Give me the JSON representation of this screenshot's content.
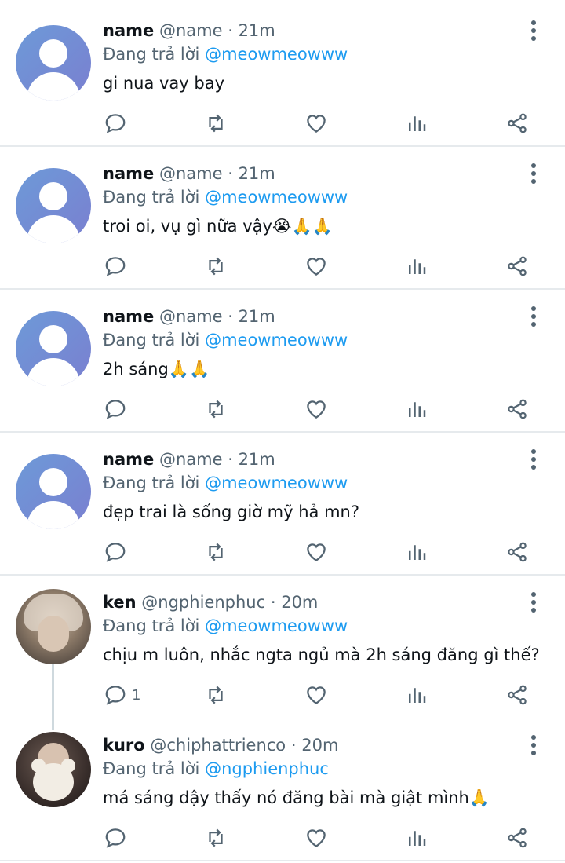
{
  "tweets": [
    {
      "name": "name",
      "handle": "@name",
      "sep": "·",
      "time": "21m",
      "reply_prefix": "Đang trả lời",
      "reply_to": "@meowmeowww",
      "text": "gi nua vay bay",
      "reply_count": "",
      "avatar": "default-avatar"
    },
    {
      "name": "name",
      "handle": "@name",
      "sep": "·",
      "time": "21m",
      "reply_prefix": "Đang trả lời",
      "reply_to": "@meowmeowww",
      "text": "troi oi, vụ gì nữa vậy😭🙏🙏",
      "reply_count": "",
      "avatar": "default-avatar"
    },
    {
      "name": "name",
      "handle": "@name",
      "sep": "·",
      "time": "21m",
      "reply_prefix": "Đang trả lời",
      "reply_to": "@meowmeowww",
      "text": "2h sáng🙏🙏",
      "reply_count": "",
      "avatar": "default-avatar"
    },
    {
      "name": "name",
      "handle": "@name",
      "sep": "·",
      "time": "21m",
      "reply_prefix": "Đang trả lời",
      "reply_to": "@meowmeowww",
      "text": "đẹp trai là sống giờ mỹ hả mn?",
      "reply_count": "",
      "avatar": "default-avatar"
    },
    {
      "name": "ken",
      "handle": "@ngphienphuc",
      "sep": "·",
      "time": "20m",
      "reply_prefix": "Đang trả lời",
      "reply_to": "@meowmeowww",
      "text": "chịu m luôn, nhắc ngta ngủ mà 2h sáng đăng gì thế?",
      "reply_count": "1",
      "avatar": "photo-avatar"
    },
    {
      "name": "kuro",
      "handle": "@chiphattrienco",
      "sep": "·",
      "time": "20m",
      "reply_prefix": "Đang trả lời",
      "reply_to": "@ngphienphuc",
      "text": "má sáng dậy thấy nó đăng bài mà giật mình🙏",
      "reply_count": "",
      "avatar": "photo-avatar"
    }
  ],
  "icons": [
    "reply-icon",
    "retweet-icon",
    "like-icon",
    "analytics-icon",
    "share-icon",
    "more-options-icon"
  ],
  "colors": {
    "mention": "#1d9bf0",
    "secondary": "#536471",
    "divider": "#e6eaed"
  }
}
